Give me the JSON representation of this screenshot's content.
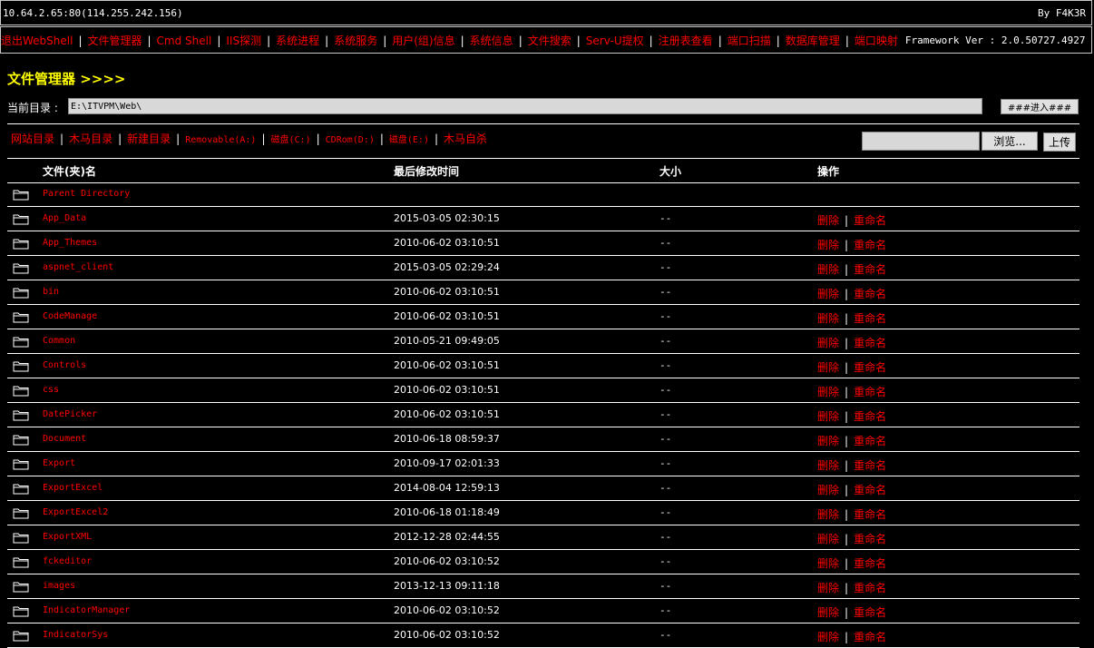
{
  "topbar": {
    "host": "10.64.2.65:80(114.255.242.156)",
    "author": "By F4K3R"
  },
  "nav": {
    "items": [
      "退出WebShell",
      "文件管理器",
      "Cmd Shell",
      "IIS探测",
      "系统进程",
      "系统服务",
      "用户(组)信息",
      "系统信息",
      "文件搜索",
      "Serv-U提权",
      "注册表查看",
      "端口扫描",
      "数据库管理",
      "端口映射"
    ],
    "framework": "Framework Ver : 2.0.50727.4927"
  },
  "page": {
    "title": "文件管理器 >>>>"
  },
  "dir": {
    "label": "当前目录 :",
    "path": "E:\\ITVPM\\Web\\",
    "go_label": "###进入###"
  },
  "drives": {
    "items": [
      "网站目录",
      "木马目录",
      "新建目录",
      "Removable(A:)",
      "磁盘(C:)",
      "CDRom(D:)",
      "磁盘(E:)",
      "木马自杀"
    ]
  },
  "upload": {
    "browse_label": "浏览...",
    "upload_label": "上传"
  },
  "table": {
    "headers": {
      "name": "文件(夹)名",
      "time": "最后修改时间",
      "size": "大小",
      "ops": "操作"
    },
    "op_delete": "删除",
    "op_rename": "重命名",
    "parent": "Parent Directory",
    "rows": [
      {
        "name": "App_Data",
        "time": "2015-03-05 02:30:15",
        "size": "--"
      },
      {
        "name": "App_Themes",
        "time": "2010-06-02 03:10:51",
        "size": "--"
      },
      {
        "name": "aspnet_client",
        "time": "2015-03-05 02:29:24",
        "size": "--"
      },
      {
        "name": "bin",
        "time": "2010-06-02 03:10:51",
        "size": "--"
      },
      {
        "name": "CodeManage",
        "time": "2010-06-02 03:10:51",
        "size": "--"
      },
      {
        "name": "Common",
        "time": "2010-05-21 09:49:05",
        "size": "--"
      },
      {
        "name": "Controls",
        "time": "2010-06-02 03:10:51",
        "size": "--"
      },
      {
        "name": "css",
        "time": "2010-06-02 03:10:51",
        "size": "--"
      },
      {
        "name": "DatePicker",
        "time": "2010-06-02 03:10:51",
        "size": "--"
      },
      {
        "name": "Document",
        "time": "2010-06-18 08:59:37",
        "size": "--"
      },
      {
        "name": "Export",
        "time": "2010-09-17 02:01:33",
        "size": "--"
      },
      {
        "name": "ExportExcel",
        "time": "2014-08-04 12:59:13",
        "size": "--"
      },
      {
        "name": "ExportExcel2",
        "time": "2010-06-18 01:18:49",
        "size": "--"
      },
      {
        "name": "ExportXML",
        "time": "2012-12-28 02:44:55",
        "size": "--"
      },
      {
        "name": "fckeditor",
        "time": "2010-06-02 03:10:52",
        "size": "--"
      },
      {
        "name": "images",
        "time": "2013-12-13 09:11:18",
        "size": "--"
      },
      {
        "name": "IndicatorManager",
        "time": "2010-06-02 03:10:52",
        "size": "--"
      },
      {
        "name": "IndicatorSys",
        "time": "2010-06-02 03:10:52",
        "size": "--"
      }
    ]
  }
}
